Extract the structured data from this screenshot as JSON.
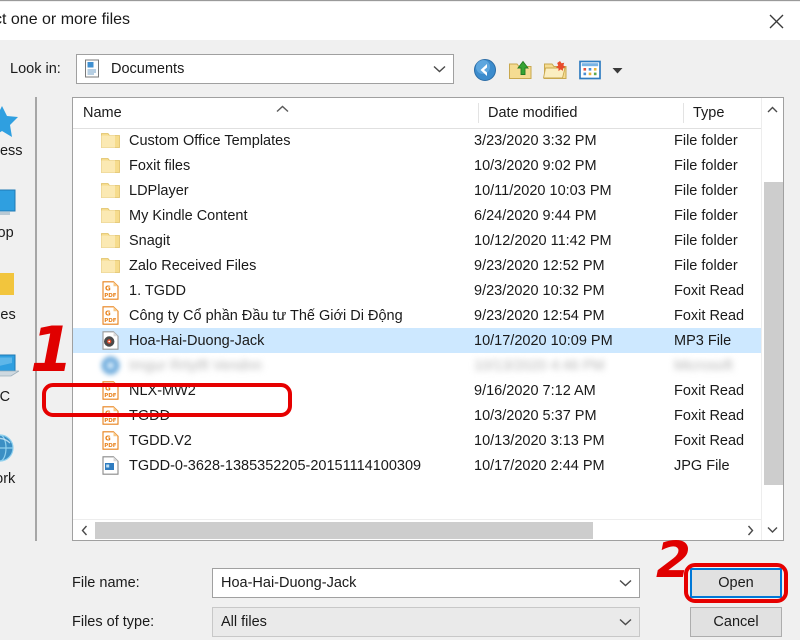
{
  "window": {
    "title": "ct one or more files",
    "close_icon": "close-icon"
  },
  "lookin": {
    "label": "Look in:",
    "value": "Documents",
    "icon": "documents-folder-icon",
    "caret_icon": "chevron-down-icon"
  },
  "toolbar": {
    "buttons": [
      {
        "name": "back-button",
        "icon": "back-arrow-icon"
      },
      {
        "name": "up-folder-button",
        "icon": "up-folder-icon"
      },
      {
        "name": "new-folder-button",
        "icon": "new-folder-icon"
      },
      {
        "name": "view-menu-button",
        "icon": "views-grid-icon"
      }
    ],
    "view_caret_icon": "chevron-down-icon"
  },
  "places": [
    {
      "label": "access",
      "icon": "quick-access-star-icon"
    },
    {
      "label": "ktop",
      "icon": "desktop-icon"
    },
    {
      "label": "aries",
      "icon": "libraries-folder-icon"
    },
    {
      "label": "PC",
      "icon": "this-pc-icon"
    },
    {
      "label": "work",
      "icon": "network-globe-icon"
    }
  ],
  "columns": [
    {
      "label": "Name",
      "sorted": "ascending"
    },
    {
      "label": "Date modified",
      "sorted": ""
    },
    {
      "label": "Type",
      "sorted": ""
    }
  ],
  "sort_caret_icon": "chevron-up-icon",
  "files": [
    {
      "name": "Custom Office Templates",
      "date": "3/23/2020 3:32 PM",
      "type": "File folder",
      "icon": "folder-icon",
      "selected": false,
      "blurred": false
    },
    {
      "name": "Foxit files",
      "date": "10/3/2020 9:02 PM",
      "type": "File folder",
      "icon": "folder-icon",
      "selected": false,
      "blurred": false
    },
    {
      "name": "LDPlayer",
      "date": "10/11/2020 10:03 PM",
      "type": "File folder",
      "icon": "folder-icon",
      "selected": false,
      "blurred": false
    },
    {
      "name": "My Kindle Content",
      "date": "6/24/2020 9:44 PM",
      "type": "File folder",
      "icon": "folder-icon",
      "selected": false,
      "blurred": false
    },
    {
      "name": "Snagit",
      "date": "10/12/2020 11:42 PM",
      "type": "File folder",
      "icon": "folder-icon",
      "selected": false,
      "blurred": false
    },
    {
      "name": "Zalo Received Files",
      "date": "9/23/2020 12:52 PM",
      "type": "File folder",
      "icon": "folder-icon",
      "selected": false,
      "blurred": false
    },
    {
      "name": "1. TGDD",
      "date": "9/23/2020 10:32 PM",
      "type": "Foxit Read",
      "icon": "pdf-file-icon",
      "selected": false,
      "blurred": false
    },
    {
      "name": "Công ty Cổ phần Đầu tư Thế Giới Di Động",
      "date": "9/23/2020 12:54 PM",
      "type": "Foxit Read",
      "icon": "pdf-file-icon",
      "selected": false,
      "blurred": false
    },
    {
      "name": "Hoa-Hai-Duong-Jack",
      "date": "10/17/2020 10:09 PM",
      "type": "MP3 File",
      "icon": "mp3-file-icon",
      "selected": true,
      "blurred": false
    },
    {
      "name": "Imgur Rrtytft Vendnn",
      "date": "10/13/2020 4:46 PM",
      "type": "Microsoft",
      "icon": "disc-blue-icon",
      "selected": false,
      "blurred": true
    },
    {
      "name": "NLX-MW2",
      "date": "9/16/2020 7:12 AM",
      "type": "Foxit Read",
      "icon": "pdf-file-icon",
      "selected": false,
      "blurred": false
    },
    {
      "name": "TGDD",
      "date": "10/3/2020 5:37 PM",
      "type": "Foxit Read",
      "icon": "pdf-file-icon",
      "selected": false,
      "blurred": false
    },
    {
      "name": "TGDD.V2",
      "date": "10/13/2020 3:13 PM",
      "type": "Foxit Read",
      "icon": "pdf-file-icon",
      "selected": false,
      "blurred": false
    },
    {
      "name": "TGDD-0-3628-1385352205-20151114100309",
      "date": "10/17/2020 2:44 PM",
      "type": "JPG File",
      "icon": "jpg-file-icon",
      "selected": false,
      "blurred": false
    }
  ],
  "scrollbars": {
    "v_up_icon": "chevron-up-icon",
    "v_down_icon": "chevron-down-icon",
    "h_left_icon": "chevron-left-icon",
    "h_right_icon": "chevron-right-icon"
  },
  "form": {
    "filename_label": "File name:",
    "filename_value": "Hoa-Hai-Duong-Jack",
    "filetype_label": "Files of type:",
    "filetype_value": "All files",
    "caret_icon": "chevron-down-icon",
    "open_label": "Open",
    "cancel_label": "Cancel"
  },
  "annotations": {
    "step1": "1",
    "step2": "2",
    "color": "#e00000"
  }
}
